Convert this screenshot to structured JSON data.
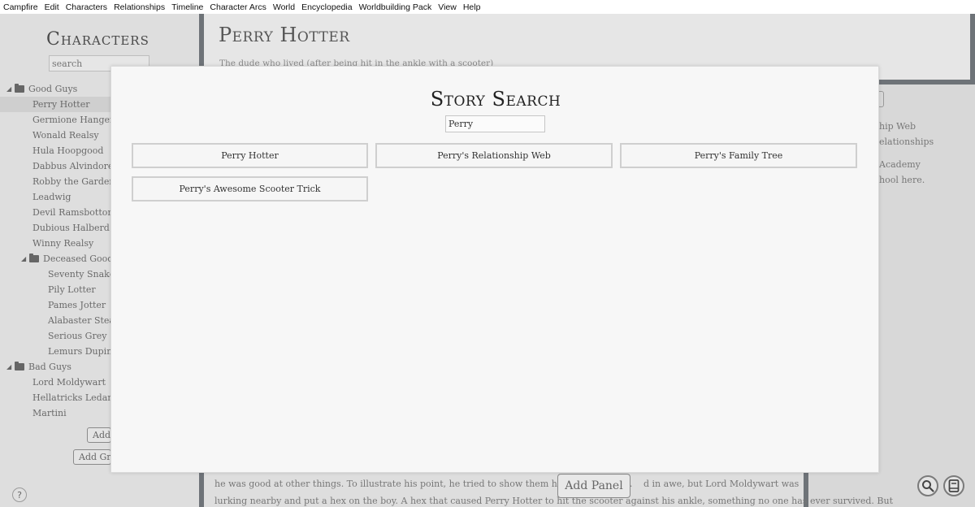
{
  "menu": [
    "Campfire",
    "Edit",
    "Characters",
    "Relationships",
    "Timeline",
    "Character Arcs",
    "World",
    "Encyclopedia",
    "Worldbuilding Pack",
    "View",
    "Help"
  ],
  "sidebar": {
    "title": "Characters",
    "search_placeholder": "search",
    "tree": [
      {
        "label": "Good Guys",
        "folder": true,
        "expanded": true,
        "level": 0
      },
      {
        "label": "Perry Hotter",
        "level": 1,
        "selected": true
      },
      {
        "label": "Germione Hanger",
        "level": 1
      },
      {
        "label": "Wonald Realsy",
        "level": 1
      },
      {
        "label": "Hula Hoopgood",
        "level": 1
      },
      {
        "label": "Dabbus Alvindore",
        "level": 1
      },
      {
        "label": "Robby the Garden G",
        "level": 1
      },
      {
        "label": "Leadwig",
        "level": 1
      },
      {
        "label": "Devil Ramsbottom",
        "level": 1
      },
      {
        "label": "Dubious Halberd",
        "level": 1
      },
      {
        "label": "Winny Realsy",
        "level": 1
      },
      {
        "label": "Deceased Good C",
        "folder": true,
        "expanded": true,
        "level": 1
      },
      {
        "label": "Seventy Snake",
        "level": 2
      },
      {
        "label": "Pily Lotter",
        "level": 2
      },
      {
        "label": "Pames Jotter",
        "level": 2
      },
      {
        "label": "Alabaster Steady",
        "level": 2
      },
      {
        "label": "Serious Grey",
        "level": 2
      },
      {
        "label": "Lemurs Dupin",
        "level": 2
      },
      {
        "label": "Bad Guys",
        "folder": true,
        "expanded": true,
        "level": 0
      },
      {
        "label": "Lord Moldywart",
        "level": 1
      },
      {
        "label": "Hellatricks Ledanger",
        "level": 1
      },
      {
        "label": "Martini",
        "level": 1
      }
    ],
    "add_button": "Add",
    "add_group_button": "Add Gro",
    "help": "?"
  },
  "page": {
    "title": "Perry Hotter",
    "subtitle": "The dude who lived (after being hit in the ankle with a scooter)",
    "right_texts": [
      "hip Web",
      "elationships",
      "Academy",
      "hool here."
    ],
    "body_lines": [
      "he was good at other things. To illustrate his point, he tried to show them his scooter tricks.",
      "d in awe, but Lord Moldywart was",
      "lurking nearby and put a hex on the boy. A hex that caused Perry Hotter to hit the scooter against his ankle, something no one has ever survived. But"
    ],
    "add_panel_button": "Add Panel"
  },
  "modal": {
    "title": "Story Search",
    "query": "Perry",
    "results": [
      "Perry Hotter",
      "Perry's Relationship Web",
      "Perry's Family Tree",
      "Perry's Awesome Scooter Trick"
    ]
  },
  "icons": {
    "search": "magnifier-icon",
    "book": "book-icon"
  }
}
